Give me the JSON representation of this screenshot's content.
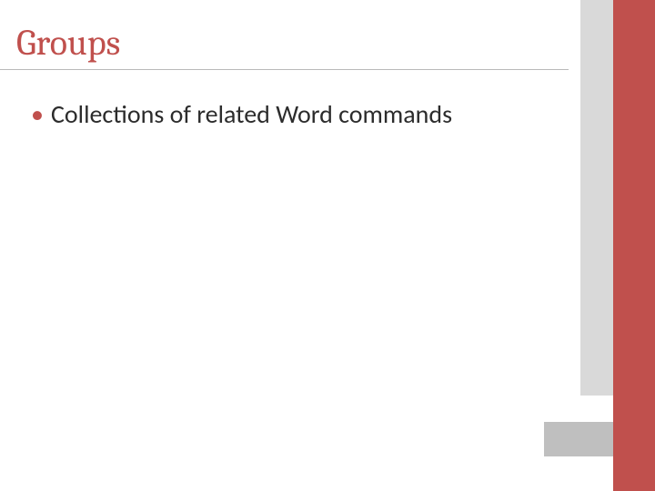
{
  "slide": {
    "title": "Groups",
    "bullets": [
      {
        "text": "Collections of related Word commands"
      }
    ]
  },
  "theme": {
    "accent": "#c0504d",
    "gray_light": "#d9d9d9",
    "gray_mid": "#bfbfbf",
    "text": "#2c2c2c"
  }
}
